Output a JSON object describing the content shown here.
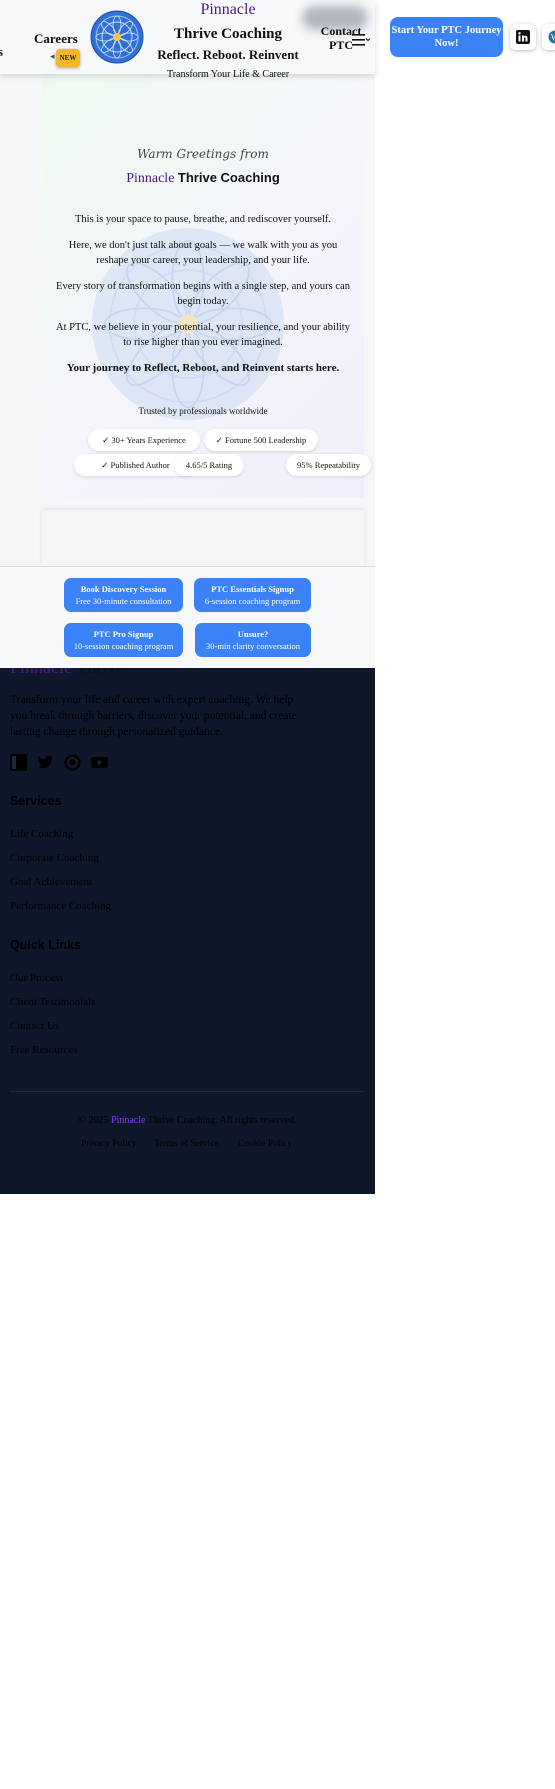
{
  "header": {
    "left_fragment": "s",
    "careers_label": "Careers",
    "new_badge": "NEW",
    "brand_pinnacle": "Pinnacle",
    "brand_thrive": "Thrive Coaching",
    "tagline": "Reflect. Reboot. Reinvent",
    "subtagline": "Transform Your Life & Career",
    "contact_label": "Contact PTC",
    "cta_label": "Start Your PTC Journey Now!",
    "social": [
      "linkedin-icon",
      "wordpress-icon"
    ]
  },
  "hero": {
    "greeting": "Warm Greetings from",
    "brand_pinnacle": "Pinnacle",
    "brand_thrive": "Thrive Coaching",
    "paragraphs": [
      "This is your space to pause, breathe, and rediscover yourself.",
      "Here, we don't just talk about goals — we walk with you as you reshape your career, your leadership, and your life.",
      "Every story of transformation begins with a single step, and yours can begin today.",
      "At PTC, we believe in your potential, your resilience, and your ability to rise higher than you ever imagined."
    ],
    "strong_line": "Your journey to Reflect, Reboot, and Reinvent starts here.",
    "trusted": "Trusted by professionals worldwide",
    "chips": [
      "✓ 30+ Years Experience",
      "✓ Fortune 500 Leadership",
      "✓ Published Author",
      "4.65/5 Rating",
      "95% Repeatability"
    ]
  },
  "sticky": {
    "buttons": [
      {
        "title": "Book Discovery Session",
        "sub": "Free 30-minute consultation"
      },
      {
        "title": "PTC Essentials Signup",
        "sub": "6-session coaching program"
      },
      {
        "title": "PTC Pro Signup",
        "sub": "10-session coaching program"
      },
      {
        "title": "Unsure?",
        "sub": "30-min clarity conversation"
      }
    ]
  },
  "footer": {
    "brand_pinnacle": "Pinnacle",
    "brand_rest": "Thrive",
    "description": "Transform your life and career with expert coaching. We help you break through barriers, discover your potential, and create lasting change through personalized guidance.",
    "social": [
      "linkedin-icon",
      "twitter-icon",
      "wordpress-icon",
      "youtube-icon"
    ],
    "services_title": "Services",
    "services": [
      "Life Coaching",
      "Corporate Coaching",
      "Goal Achievement",
      "Performance Coaching"
    ],
    "quicklinks_title": "Quick Links",
    "quicklinks": [
      "Our Process",
      "Client Testimonials",
      "Contact Us",
      "Free Resources"
    ],
    "copyright_prefix": "© 2025",
    "copyright_brand": "Pinnacle",
    "copyright_suffix": "Thrive Coaching. All rights reserved.",
    "legal": [
      "Privacy Policy",
      "Terms of Service",
      "Cookie Policy"
    ]
  },
  "colors": {
    "accent_blue": "#3b82f6",
    "brand_purple": "#4b1a86",
    "footer_bg": "#0f172a",
    "badge_yellow": "#f5b728"
  }
}
